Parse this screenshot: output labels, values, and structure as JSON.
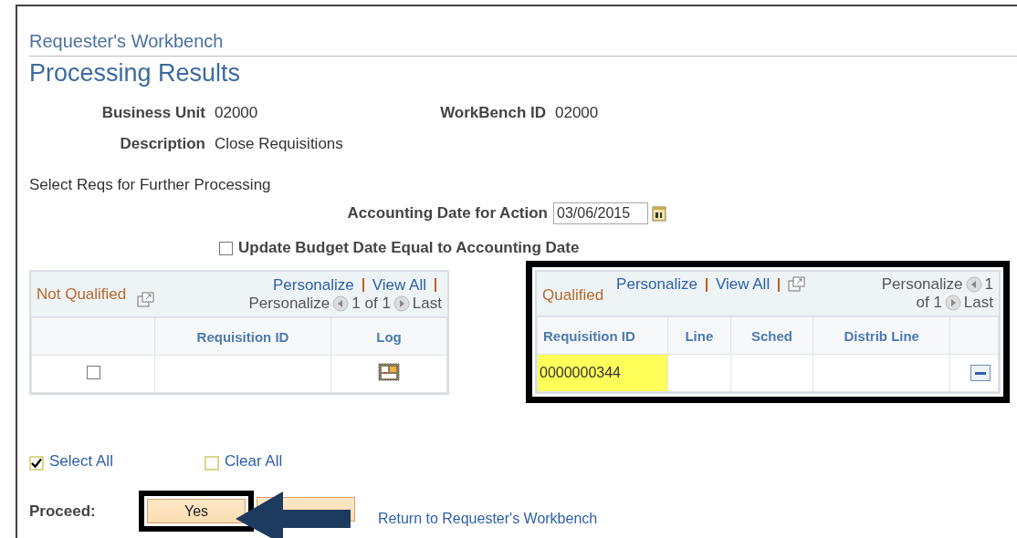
{
  "breadcrumb": "Requester's Workbench",
  "page_title": "Processing Results",
  "fields": [
    {
      "label": "Business Unit",
      "value": "02000"
    },
    {
      "label": "WorkBench ID",
      "value": "02000"
    },
    {
      "label": "Description",
      "value": "Close Requisitions"
    }
  ],
  "instruction": "Select Reqs for Further Processing",
  "accounting_date": {
    "label": "Accounting Date for Action",
    "value": "03/06/2015"
  },
  "update_budget": {
    "label": "Update Budget Date Equal to Accounting Date",
    "checked": false
  },
  "not_qualified_grid": {
    "title": "Not Qualified",
    "personalize_link": "Personalize",
    "view_all_link": "View All",
    "personalize_text": "Personalize",
    "page_range": "1 of 1",
    "last": "Last",
    "columns": [
      "Requisition ID",
      "Log"
    ],
    "rows": [
      {
        "checked": false
      }
    ]
  },
  "qualified_grid": {
    "title": "Qualified",
    "highlighted": true,
    "personalize_link": "Personalize",
    "view_all_link": "View All",
    "personalize_text": "Personalize",
    "page_range": "1 of 1",
    "last": "Last",
    "columns": [
      "Requisition ID",
      "Line",
      "Sched",
      "Distrib Line"
    ],
    "rows": [
      {
        "requisition_id": "0000000344",
        "highlighted": true
      }
    ]
  },
  "select_all": {
    "label": "Select All",
    "checked": true
  },
  "clear_all": {
    "label": "Clear All",
    "checked": false
  },
  "proceed": {
    "label": "Proceed:",
    "buttons": [
      {
        "label": "Yes",
        "highlighted": true
      },
      {
        "highlighted": false
      }
    ]
  },
  "return_link": "Return to Requester's Workbench"
}
